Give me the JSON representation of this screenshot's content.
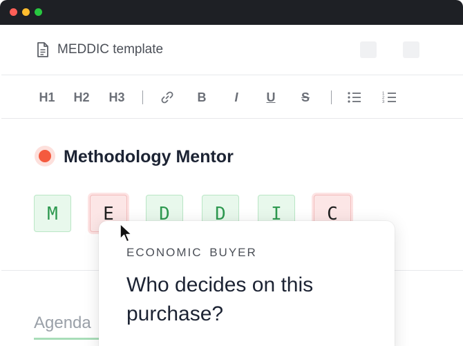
{
  "window": {
    "controls": [
      "close",
      "minimize",
      "maximize"
    ]
  },
  "document": {
    "icon": "document-icon",
    "title": "MEDDIC template"
  },
  "toolbar": {
    "h1": "H1",
    "h2": "H2",
    "h3": "H3",
    "bold": "B",
    "italic": "I",
    "underline": "U",
    "strikethrough": "S",
    "icons": [
      "link-icon",
      "bulleted-list-icon",
      "numbered-list-icon"
    ]
  },
  "mentor": {
    "title": "Methodology Mentor",
    "status_color": "#f45a3e"
  },
  "meddic": [
    {
      "letter": "M",
      "state": "complete"
    },
    {
      "letter": "E",
      "state": "missing"
    },
    {
      "letter": "D",
      "state": "complete"
    },
    {
      "letter": "D",
      "state": "complete"
    },
    {
      "letter": "I",
      "state": "complete"
    },
    {
      "letter": "C",
      "state": "missing"
    }
  ],
  "colors": {
    "complete": "#2e9950",
    "missing": "#e05555"
  },
  "section": {
    "label": "Agenda"
  },
  "popover": {
    "label": "ECONOMIC BUYER",
    "question": "Who decides on this purchase?"
  }
}
